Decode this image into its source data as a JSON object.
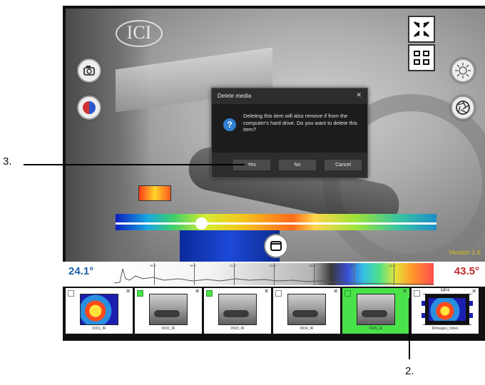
{
  "viewer": {
    "logo_text": "ICI",
    "version": "Version 1.6"
  },
  "dialog": {
    "title": "Delete media",
    "message": "Deleting this item will also remove if from the computer's hard drive. Do you want to delete this item?",
    "buttons": {
      "yes": "Yes",
      "no": "No",
      "cancel": "Cancel"
    }
  },
  "range": {
    "min_label": "24.1°",
    "max_label": "43.5°",
    "colors": {
      "min": "#1e5fa6",
      "max": "#c02828"
    },
    "ticks": [
      "26.5°",
      "28.9°",
      "31.4°",
      "33.8°",
      "36.2°",
      "38.7°",
      "41.1°"
    ]
  },
  "thumbnails": [
    {
      "caption": "0001_IR",
      "checked": false,
      "selected": false,
      "kind": "ir"
    },
    {
      "caption": "0002_IR",
      "checked": true,
      "selected": false,
      "kind": "gray"
    },
    {
      "caption": "0003_IR",
      "checked": true,
      "selected": false,
      "kind": "gray"
    },
    {
      "caption": "0004_IR",
      "checked": false,
      "selected": false,
      "kind": "gray"
    },
    {
      "caption": "0005_IR",
      "checked": true,
      "selected": true,
      "kind": "gray"
    },
    {
      "caption": "IRImages_Video",
      "badge": "MP4",
      "checked": false,
      "selected": false,
      "kind": "video"
    }
  ],
  "annotations": {
    "callout_3": "3.",
    "callout_2": "2."
  },
  "icons": {
    "left": [
      "camera-icon",
      "palette-icon"
    ],
    "right": [
      "brightness-icon",
      "aperture-icon"
    ],
    "top_right": [
      "collapse-icon",
      "grid-view-icon"
    ],
    "bottom": "fullscreen-icon",
    "dialog": "question-icon"
  }
}
